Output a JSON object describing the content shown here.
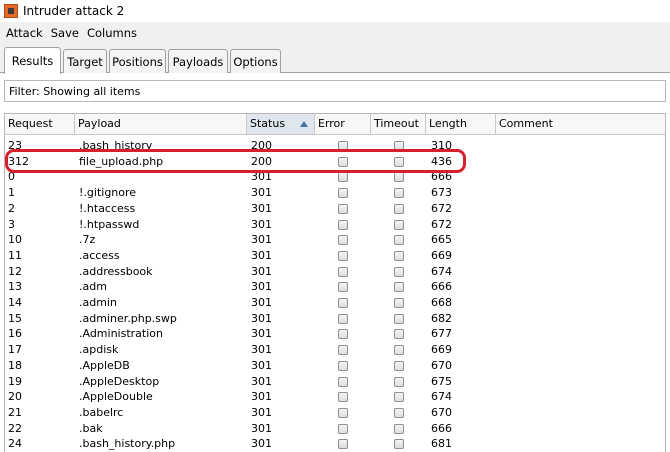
{
  "window": {
    "title": "Intruder attack 2"
  },
  "menu": {
    "items": [
      "Attack",
      "Save",
      "Columns"
    ]
  },
  "tabs": [
    "Results",
    "Target",
    "Positions",
    "Payloads",
    "Options"
  ],
  "filter": {
    "text": "Filter:  Showing all items"
  },
  "table": {
    "columns": [
      "Request",
      "Payload",
      "Status",
      "Error",
      "Timeout",
      "Length",
      "Comment"
    ],
    "sorted_column": "Status",
    "rows": [
      [
        "23",
        ".bash_history",
        "200",
        "310"
      ],
      [
        "312",
        "file_upload.php",
        "200",
        "436"
      ],
      [
        "0",
        "",
        "301",
        "666"
      ],
      [
        "1",
        "!.gitignore",
        "301",
        "673"
      ],
      [
        "2",
        "!.htaccess",
        "301",
        "672"
      ],
      [
        "3",
        "!.htpasswd",
        "301",
        "672"
      ],
      [
        "10",
        ".7z",
        "301",
        "665"
      ],
      [
        "11",
        ".access",
        "301",
        "669"
      ],
      [
        "12",
        ".addressbook",
        "301",
        "674"
      ],
      [
        "13",
        ".adm",
        "301",
        "666"
      ],
      [
        "14",
        ".admin",
        "301",
        "668"
      ],
      [
        "15",
        ".adminer.php.swp",
        "301",
        "682"
      ],
      [
        "16",
        ".Administration",
        "301",
        "677"
      ],
      [
        "17",
        ".apdisk",
        "301",
        "669"
      ],
      [
        "18",
        ".AppleDB",
        "301",
        "670"
      ],
      [
        "19",
        ".AppleDesktop",
        "301",
        "675"
      ],
      [
        "20",
        ".AppleDouble",
        "301",
        "674"
      ],
      [
        "21",
        ".babelrc",
        "301",
        "670"
      ],
      [
        "22",
        ".bak",
        "301",
        "666"
      ],
      [
        "24",
        ".bash_history.php",
        "301",
        "681"
      ]
    ]
  },
  "colors": {
    "highlight": "#d6202c",
    "sort_arrow": "#4a6fa5"
  }
}
